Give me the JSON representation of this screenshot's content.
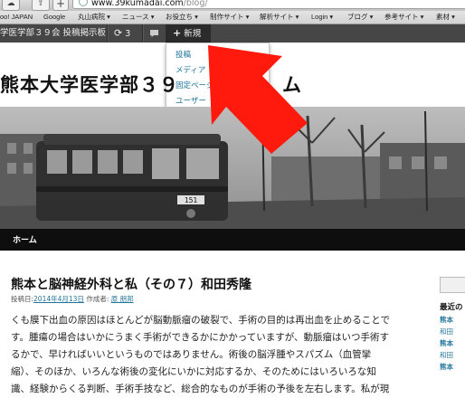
{
  "browser": {
    "url_host": "www.39kumadai.com",
    "url_path": "/blog/",
    "nav_add_glyph": "+",
    "nav_share_glyph": "⇧"
  },
  "bookmarks": [
    "oo! JAPAN",
    "Google",
    "丸山病院 ▾",
    "ニュース ▾",
    "お役立ち ▾",
    "制作サイト ▾",
    "解析サイト ▾",
    "Login ▾",
    "ブログ ▾",
    "参考サイト ▾",
    "素材 ▾"
  ],
  "adminbar": {
    "site_name": "学医学部３９会 投稿掲示板",
    "updates_count": "3",
    "new_label": "新規"
  },
  "new_menu": [
    "投稿",
    "メディア",
    "固定ページ",
    "ユーザー"
  ],
  "site": {
    "title_start": "熊本大学医学部３９",
    "title_end": "ム"
  },
  "banner": {
    "tram_number": "151"
  },
  "nav": {
    "home": "ホーム"
  },
  "post": {
    "title": "熊本と脳神経外科と私（その７）和田秀隆",
    "posted_label": "投稿日:",
    "date": "2014年4月13日",
    "author_label": "作成者:",
    "author": "原 朋邦",
    "lines": [
      "くも膜下出血の原因はほとんどが脳動脈瘤の破裂で、手術の目的は再出血を止めることで",
      "す。腫瘍の場合はいかにうまく手術ができるかにかかっていますが、動脈瘤はいつ手術す",
      "るかで、早ければいいというものではありません。術後の脳浮腫やスパズム（血管攣",
      "縮）、そのほか、いろんな術後の変化にいかに対応するか、そのためにはいろいろな知",
      "識、経験からくる判断、手術手技など、総合的なものが手術の予後を左右します。私が現"
    ]
  },
  "sidebar": {
    "heading": "最近の",
    "links": [
      {
        "bold": "熊本",
        "rest": ""
      },
      {
        "bold": "",
        "rest": "和田"
      },
      {
        "bold": "熊本",
        "rest": ""
      },
      {
        "bold": "",
        "rest": "和田"
      },
      {
        "bold": "熊本",
        "rest": ""
      }
    ]
  },
  "colors": {
    "adminbar": "#464646",
    "nav": "#0e0e0e",
    "link": "#21759b",
    "arrow": "#ff1a0d"
  }
}
